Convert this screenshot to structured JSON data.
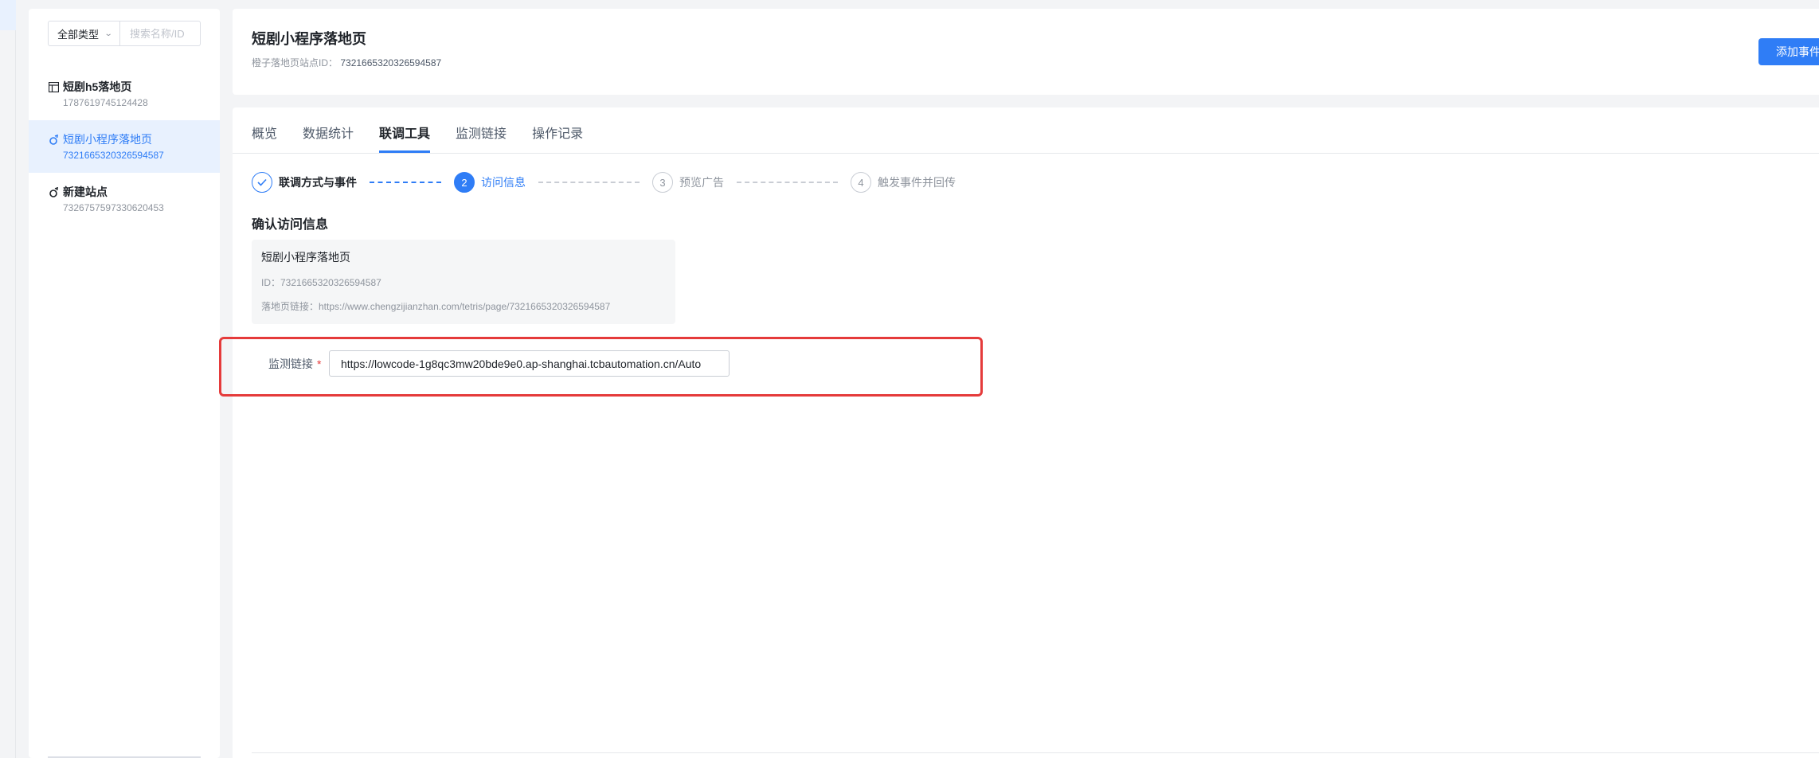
{
  "sidebar": {
    "type_filter": "全部类型",
    "search_placeholder": "搜索名称/ID",
    "items": [
      {
        "name": "短剧h5落地页",
        "id": "1787619745124428",
        "icon": "layout-icon"
      },
      {
        "name": "短剧小程序落地页",
        "id": "7321665320326594587",
        "icon": "miniprogram-icon"
      },
      {
        "name": "新建站点",
        "id": "7326757597330620453",
        "icon": "miniprogram-icon"
      }
    ]
  },
  "header": {
    "title": "短剧小程序落地页",
    "site_id_label": "橙子落地页站点ID：",
    "site_id": "7321665320326594587",
    "add_event_button": "添加事件"
  },
  "tabs": [
    "概览",
    "数据统计",
    "联调工具",
    "监测链接",
    "操作记录"
  ],
  "active_tab": "联调工具",
  "steps": [
    {
      "num": "1",
      "label": "联调方式与事件",
      "status": "done"
    },
    {
      "num": "2",
      "label": "访问信息",
      "status": "current"
    },
    {
      "num": "3",
      "label": "预览广告",
      "status": "pending"
    },
    {
      "num": "4",
      "label": "触发事件并回传",
      "status": "pending"
    }
  ],
  "confirm": {
    "title": "确认访问信息",
    "page_name": "短剧小程序落地页",
    "id_line": "ID：7321665320326594587",
    "url_line": "落地页链接：https://www.chengzijianzhan.com/tetris/page/7321665320326594587"
  },
  "monitor": {
    "label": "监测链接",
    "required_mark": "*",
    "value": "https://lowcode-1g8qc3mw20bde9e0.ap-shanghai.tcbautomation.cn/Auto"
  },
  "colors": {
    "primary": "#2f7df6",
    "highlight": "#e53b3b"
  }
}
